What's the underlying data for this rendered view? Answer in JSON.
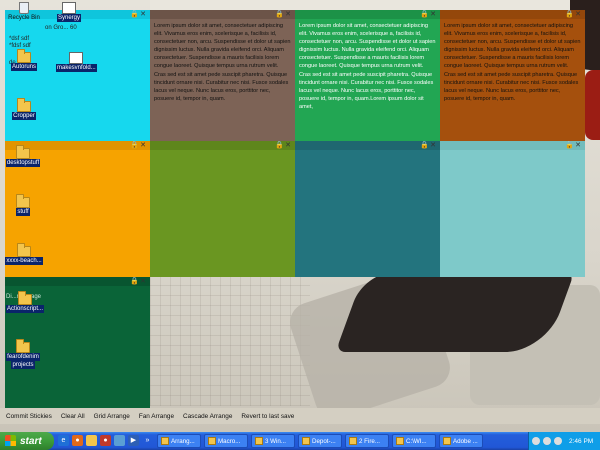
{
  "lorem_short": "Lorem ipsum dolor sit amet, consectetuer adipiscing elit. Vivamus eros enim, scelerisque a, facilisis id, consectetuer non, arcu. Suspendisse et dolor ut sapien dignissim luctus. Nulla gravida eleifend orci. Aliquam consectetuer. Suspendisse a mauris facilisis lorem congue laoreet. Quisque tempus urna rutrum velit. Cras sed est sit amet pede suscipit pharetra. Quisque tincidunt ornare nisi. Curabitur nec nisi. Fusce sodales lacus vel neque. Nunc lacus eros, porttitor nec, posuere id, tempor in, quam.",
  "lorem_long": "Lorem ipsum dolor sit amet, consectetuer adipiscing elit. Vivamus eros enim, scelerisque a, facilisis id, consectetuer non, arcu. Suspendisse et dolor ut sapien dignissim luctus. Nulla gravida eleifend orci. Aliquam consectetuer. Suspendisse a mauris facilisis lorem congue laoreet. Quisque tempus urna rutrum velit. Cras sed est sit amet pede suscipit pharetra. Quisque tincidunt ornare nisi. Curabitur nec nisi. Fusce sodales lacus vel neque. Nunc lacus eros, porttitor nec, posuere id, tempor in, quam.Lorem ipsum dolor sit amet,",
  "notes": [
    {
      "color": "#16d8ee",
      "bar": "#0fc5dc"
    },
    {
      "color": "#7d6356",
      "bar": "#6c5448"
    },
    {
      "color": "#22a653",
      "bar": "#1c9247"
    },
    {
      "color": "#a5500d",
      "bar": "#94470b"
    },
    {
      "color": "#f6a300",
      "bar": "#e09400"
    },
    {
      "color": "#6a9621",
      "bar": "#5e861c"
    },
    {
      "color": "#23747e",
      "bar": "#1f6770"
    },
    {
      "color": "#7ec9c9",
      "bar": "#72bcbc"
    },
    {
      "color": "#0a6438",
      "bar": "#085530"
    }
  ],
  "desktop": {
    "overlay_lines": [
      "*dsf sdf",
      "*fdsf sdf"
    ],
    "overlay_top_text": "on Gro...",
    "overlay_top_num": "60",
    "overlay_de": "de",
    "message_text": "Di...message",
    "icons": {
      "recycle_bin": "Recycle Bin",
      "synergy": "Synergy",
      "autoruns": "Autoruns",
      "makesvnfold": "makesvnfold...",
      "cropper": "Cropper",
      "desktopstuff": "desktopstuff",
      "stuff": "stuff",
      "beach": "xxxx-beach...",
      "actionscript": "Actionscript...",
      "fearofdenim": "fearofdenim",
      "projects": "projects"
    }
  },
  "commands": [
    "Commit Stickies",
    "Clear All",
    "Grid Arrange",
    "Fan Arrange",
    "Cascade Arrange",
    "Revert to last save"
  ],
  "taskbar": {
    "start_label": "start",
    "tasks": [
      "Arrang...",
      "Macro...",
      "3 Win...",
      "Depot-...",
      "2 Fire...",
      "C:\\WI...",
      "Adobe ..."
    ],
    "clock": "2:46 PM"
  }
}
